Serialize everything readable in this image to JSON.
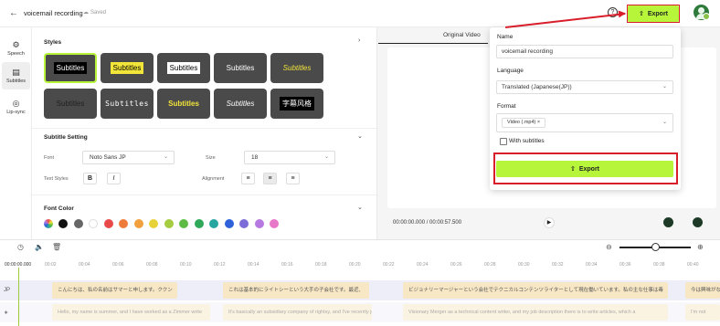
{
  "header": {
    "back_icon": "arrow-left-icon",
    "project_title": "voicemail recording",
    "saved_label": "Saved",
    "help_icon": "?",
    "export_label": "Export"
  },
  "leftnav": {
    "items": [
      {
        "label": "Speech",
        "icon": "speech-icon"
      },
      {
        "label": "Subtitles",
        "icon": "subtitles-icon"
      },
      {
        "label": "Lip-sync",
        "icon": "lip-sync-icon"
      }
    ],
    "active": "Subtitles"
  },
  "styles": {
    "title": "Styles",
    "tiles": [
      {
        "text": "Subtitles"
      },
      {
        "text": "Subtitles"
      },
      {
        "text": "Subtitles"
      },
      {
        "text": "Subtitles"
      },
      {
        "text": "Subtitles"
      },
      {
        "text": "Subtitles"
      },
      {
        "text": "Subtitles"
      },
      {
        "text": "Subtitles"
      },
      {
        "text": "Subtitles"
      },
      {
        "text": "字幕风格"
      }
    ]
  },
  "subtitle_setting": {
    "title": "Subtitle Setting",
    "font_label": "Font",
    "font_value": "Noto Sans JP",
    "size_label": "Size",
    "size_value": "18",
    "text_styles_label": "Text Styles",
    "bold": "B",
    "italic": "I",
    "alignment_label": "Alignment"
  },
  "font_color": {
    "title": "Font Color",
    "swatches": [
      "#ffffff",
      "#111111",
      "#666666",
      "#ffffff",
      "#e84a4a",
      "#ef7b3b",
      "#f2a03d",
      "#e8d23a",
      "#a6cc3f",
      "#5dbb44",
      "#2fa85a",
      "#27a6a0",
      "#2f62d9",
      "#7b6cd8",
      "#b77ae0",
      "#e878c8"
    ]
  },
  "preview": {
    "tab_label": "Original Video",
    "timecode": "00:00:00.000 / 00:00:57.500"
  },
  "export_popup": {
    "name_label": "Name",
    "name_value": "voicemail recording",
    "language_label": "Language",
    "language_value": "Translated (Japanese(JP))",
    "format_label": "Format",
    "format_chip": "Video (.mp4)",
    "with_subtitles_label": "With subtitles",
    "with_subtitles_checked": false,
    "export_label": "Export"
  },
  "timeline": {
    "current": "00:00:00.000",
    "ticks": [
      "00:02",
      "00:04",
      "00:06",
      "00:08",
      "00:10",
      "00:12",
      "00:14",
      "00:16",
      "00:18",
      "00:20",
      "00:22",
      "00:24",
      "00:26",
      "00:28",
      "00:30",
      "00:32",
      "00:34",
      "00:36",
      "00:38",
      "00:40"
    ],
    "jp_track_label": "JP",
    "jp_segments": [
      "こんにちは、私の名前はサマーと申します。ククン",
      "これは基本的にライトシーという大手の子会社です。最近、",
      "ビジョナリーマージャーという会社でテクニカルコンテンツライターとして現在働いています。私の主な仕事は毒",
      "今は興味がな"
    ],
    "en_segments": [
      "Hello, my name is summer, and I have worked as a Zimmer write",
      "It's basically an subsidiary company of rightsy, and I've recently jo",
      "Visionary Merger as a technical content writer, and my job description there is to write articles, which a",
      "I'm not"
    ]
  }
}
